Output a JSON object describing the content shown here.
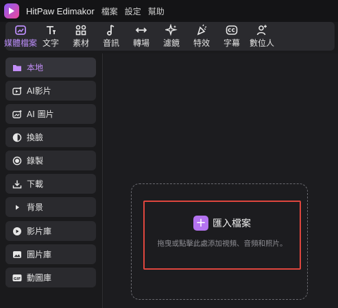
{
  "app": {
    "name": "HitPaw Edimakor"
  },
  "menu": [
    "檔案",
    "設定",
    "幫助"
  ],
  "toolbar": {
    "tools": [
      {
        "label": "媒體檔案",
        "icon": "media-icon",
        "active": true
      },
      {
        "label": "文字",
        "icon": "text-icon"
      },
      {
        "label": "素材",
        "icon": "elements-icon"
      },
      {
        "label": "音訊",
        "icon": "audio-icon"
      },
      {
        "label": "轉場",
        "icon": "transition-icon"
      },
      {
        "label": "濾鏡",
        "icon": "filter-icon"
      },
      {
        "label": "特效",
        "icon": "effects-icon"
      },
      {
        "label": "字幕",
        "icon": "subtitle-icon"
      },
      {
        "label": "數位人",
        "icon": "digital-human-icon"
      }
    ]
  },
  "sidebar": {
    "items": [
      {
        "label": "本地",
        "icon": "folder-icon",
        "active": true
      },
      {
        "label": "AI影片",
        "icon": "ai-video-icon"
      },
      {
        "label": "AI 圖片",
        "icon": "ai-image-icon"
      },
      {
        "label": "換臉",
        "icon": "face-swap-icon"
      },
      {
        "label": "錄製",
        "icon": "record-icon"
      },
      {
        "label": "下載",
        "icon": "download-icon"
      },
      {
        "label": "背景",
        "icon": "background-icon"
      },
      {
        "label": "影片庫",
        "icon": "video-library-icon"
      },
      {
        "label": "圖片庫",
        "icon": "image-library-icon"
      },
      {
        "label": "動圖庫",
        "icon": "gif-library-icon"
      }
    ]
  },
  "import": {
    "label": "匯入檔案",
    "hint": "拖曳或點擊此處添加視頻、音頻和照片。"
  },
  "colors": {
    "accent": "#b473f0",
    "highlight_border": "#e0463e"
  }
}
